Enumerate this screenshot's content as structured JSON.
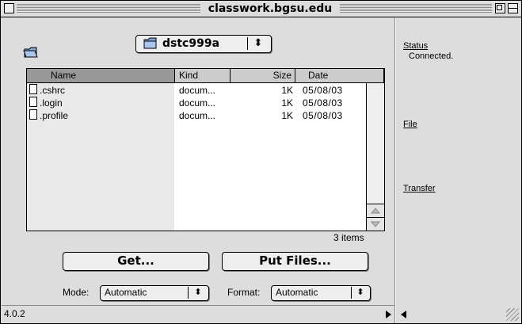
{
  "window": {
    "title": "classwork.bgsu.edu",
    "version": "4.0.2"
  },
  "directory_popup": {
    "label": "dstc999a",
    "arrows": "⬍"
  },
  "file_list": {
    "columns": [
      "Name",
      "Kind",
      "Size",
      "Date"
    ],
    "rows": [
      {
        "name": ".cshrc",
        "kind": "docum...",
        "size": "1K",
        "date": "05/08/03"
      },
      {
        "name": ".login",
        "kind": "docum...",
        "size": "1K",
        "date": "05/08/03"
      },
      {
        "name": ".profile",
        "kind": "docum...",
        "size": "1K",
        "date": "05/08/03"
      }
    ],
    "count_text": "3 items"
  },
  "buttons": {
    "get": "Get...",
    "put": "Put Files..."
  },
  "mode": {
    "label": "Mode:",
    "value": "Automatic"
  },
  "format": {
    "label": "Format:",
    "value": "Automatic"
  },
  "sidebar": {
    "status_label": "Status",
    "status_value": "Connected.",
    "file_label": "File",
    "transfer_label": "Transfer"
  },
  "icons": [
    "folder-icon",
    "document-icon",
    "up-arrow-icon",
    "down-arrow-icon",
    "close-box-icon",
    "zoom-box-icon",
    "collapse-box-icon",
    "grow-box-icon"
  ]
}
